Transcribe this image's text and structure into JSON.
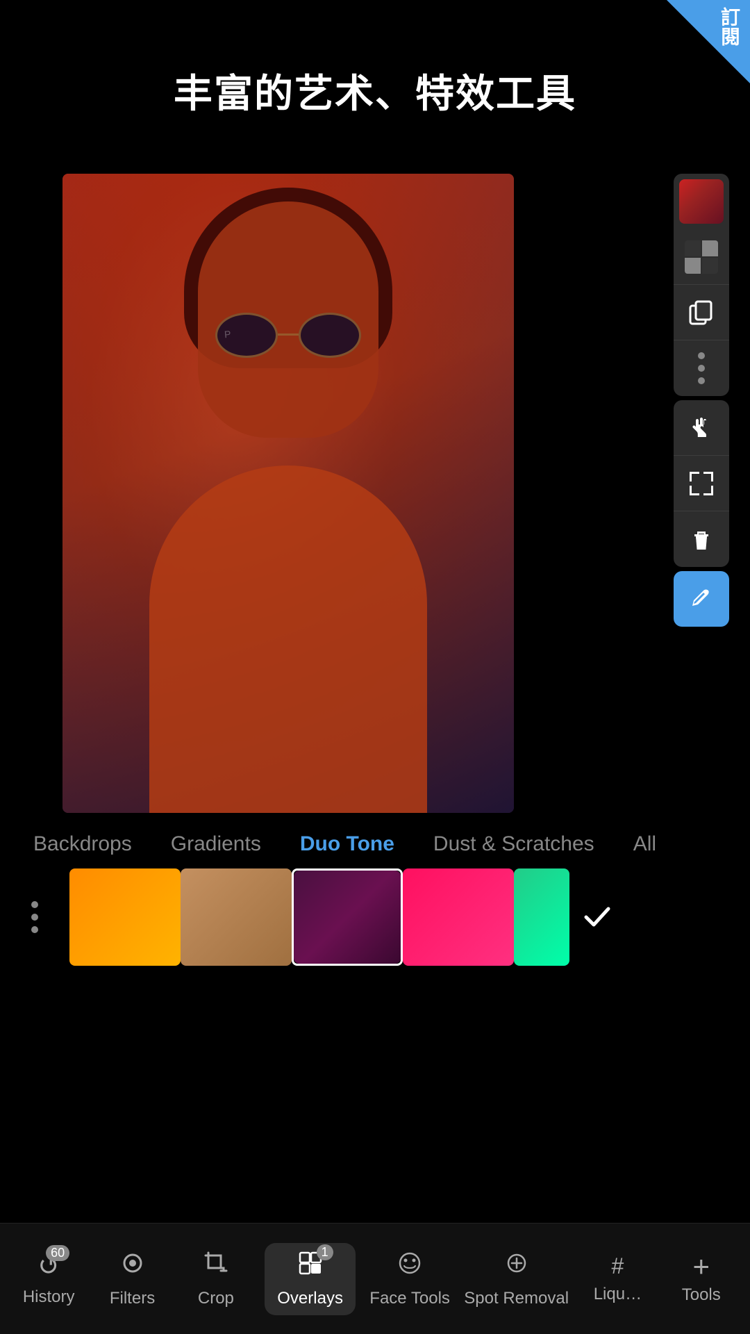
{
  "app": {
    "corner_badge": "訂閱",
    "title": "丰富的艺术、特效工具"
  },
  "right_panel": {
    "icons": [
      {
        "name": "color-swatch",
        "type": "swatch"
      },
      {
        "name": "checker",
        "type": "checker"
      },
      {
        "name": "duplicate",
        "type": "unicode",
        "char": "⧉"
      },
      {
        "name": "more",
        "type": "dots"
      }
    ],
    "mid_icons": [
      {
        "name": "hand",
        "type": "unicode",
        "char": "✋"
      },
      {
        "name": "select",
        "type": "unicode",
        "char": "⬚"
      },
      {
        "name": "delete",
        "type": "unicode",
        "char": "🗑"
      }
    ],
    "eye_dropper": "💉"
  },
  "category_tabs": [
    {
      "label": "Backdrops",
      "active": false
    },
    {
      "label": "Gradients",
      "active": false
    },
    {
      "label": "Duo Tone",
      "active": true
    },
    {
      "label": "Dust & Scratches",
      "active": false
    },
    {
      "label": "All",
      "active": false
    }
  ],
  "overlays": [
    {
      "type": "menu",
      "id": "menu-dots"
    },
    {
      "type": "color",
      "style": "orange",
      "id": "thumb-1"
    },
    {
      "type": "color",
      "style": "tan",
      "id": "thumb-2"
    },
    {
      "type": "color",
      "style": "darkred",
      "id": "thumb-3"
    },
    {
      "type": "color",
      "style": "pink",
      "id": "thumb-4"
    },
    {
      "type": "color",
      "style": "green",
      "id": "thumb-5"
    }
  ],
  "bottom_nav": [
    {
      "label": "History",
      "badge": "60",
      "icon": "↺",
      "active": false
    },
    {
      "label": "Filters",
      "icon": "⊙",
      "active": false
    },
    {
      "label": "Crop",
      "icon": "⌧",
      "active": false
    },
    {
      "label": "Overlays",
      "icon": "⊞",
      "badge": "1",
      "active": true
    },
    {
      "label": "Face Tools",
      "icon": "☺",
      "active": false
    },
    {
      "label": "Spot Removal",
      "icon": "✂",
      "active": false
    },
    {
      "label": "Liqu…",
      "icon": "#",
      "active": false
    },
    {
      "label": "Tools",
      "icon": "+",
      "active": false
    }
  ]
}
